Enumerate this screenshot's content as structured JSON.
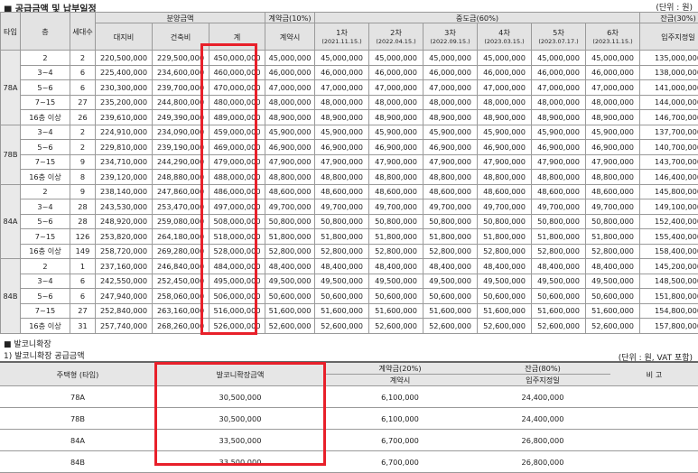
{
  "title": "■ 공급금액 및 납부일정",
  "unit": "(단위 : 원)",
  "headers": {
    "type": "타입",
    "floor": "층",
    "households": "세대수",
    "sale_price": "분양금액",
    "land": "대지비",
    "building": "건축비",
    "total": "계",
    "contract": "계약금(10%)",
    "contract_when": "계약시",
    "middle": "중도금(60%)",
    "rounds": [
      {
        "label": "1차",
        "date": "(2021.11.15.)"
      },
      {
        "label": "2차",
        "date": "(2022.04.15.)"
      },
      {
        "label": "3차",
        "date": "(2022.09.15.)"
      },
      {
        "label": "4차",
        "date": "(2023.03.15.)"
      },
      {
        "label": "5차",
        "date": "(2023.07.17.)"
      },
      {
        "label": "6차",
        "date": "(2023.11.15.)"
      }
    ],
    "balance": "잔금(30%)",
    "balance_when": "입주지정일"
  },
  "groups": [
    {
      "type": "78A",
      "rows": [
        {
          "floor": "2",
          "units": "2",
          "land": "220,500,000",
          "building": "229,500,000",
          "total": "450,000,000",
          "contract": "45,000,000",
          "mid": "45,000,000",
          "balance": "135,000,000"
        },
        {
          "floor": "3~4",
          "units": "6",
          "land": "225,400,000",
          "building": "234,600,000",
          "total": "460,000,000",
          "contract": "46,000,000",
          "mid": "46,000,000",
          "balance": "138,000,000"
        },
        {
          "floor": "5~6",
          "units": "6",
          "land": "230,300,000",
          "building": "239,700,000",
          "total": "470,000,000",
          "contract": "47,000,000",
          "mid": "47,000,000",
          "balance": "141,000,000"
        },
        {
          "floor": "7~15",
          "units": "27",
          "land": "235,200,000",
          "building": "244,800,000",
          "total": "480,000,000",
          "contract": "48,000,000",
          "mid": "48,000,000",
          "balance": "144,000,000"
        },
        {
          "floor": "16층 이상",
          "units": "26",
          "land": "239,610,000",
          "building": "249,390,000",
          "total": "489,000,000",
          "contract": "48,900,000",
          "mid": "48,900,000",
          "balance": "146,700,000"
        }
      ]
    },
    {
      "type": "78B",
      "rows": [
        {
          "floor": "3~4",
          "units": "2",
          "land": "224,910,000",
          "building": "234,090,000",
          "total": "459,000,000",
          "contract": "45,900,000",
          "mid": "45,900,000",
          "balance": "137,700,000"
        },
        {
          "floor": "5~6",
          "units": "2",
          "land": "229,810,000",
          "building": "239,190,000",
          "total": "469,000,000",
          "contract": "46,900,000",
          "mid": "46,900,000",
          "balance": "140,700,000"
        },
        {
          "floor": "7~15",
          "units": "9",
          "land": "234,710,000",
          "building": "244,290,000",
          "total": "479,000,000",
          "contract": "47,900,000",
          "mid": "47,900,000",
          "balance": "143,700,000"
        },
        {
          "floor": "16층 이상",
          "units": "8",
          "land": "239,120,000",
          "building": "248,880,000",
          "total": "488,000,000",
          "contract": "48,800,000",
          "mid": "48,800,000",
          "balance": "146,400,000"
        }
      ]
    },
    {
      "type": "84A",
      "rows": [
        {
          "floor": "2",
          "units": "9",
          "land": "238,140,000",
          "building": "247,860,000",
          "total": "486,000,000",
          "contract": "48,600,000",
          "mid": "48,600,000",
          "balance": "145,800,000"
        },
        {
          "floor": "3~4",
          "units": "28",
          "land": "243,530,000",
          "building": "253,470,000",
          "total": "497,000,000",
          "contract": "49,700,000",
          "mid": "49,700,000",
          "balance": "149,100,000"
        },
        {
          "floor": "5~6",
          "units": "28",
          "land": "248,920,000",
          "building": "259,080,000",
          "total": "508,000,000",
          "contract": "50,800,000",
          "mid": "50,800,000",
          "balance": "152,400,000"
        },
        {
          "floor": "7~15",
          "units": "126",
          "land": "253,820,000",
          "building": "264,180,000",
          "total": "518,000,000",
          "contract": "51,800,000",
          "mid": "51,800,000",
          "balance": "155,400,000"
        },
        {
          "floor": "16층 이상",
          "units": "149",
          "land": "258,720,000",
          "building": "269,280,000",
          "total": "528,000,000",
          "contract": "52,800,000",
          "mid": "52,800,000",
          "balance": "158,400,000"
        }
      ]
    },
    {
      "type": "84B",
      "rows": [
        {
          "floor": "2",
          "units": "1",
          "land": "237,160,000",
          "building": "246,840,000",
          "total": "484,000,000",
          "contract": "48,400,000",
          "mid": "48,400,000",
          "balance": "145,200,000"
        },
        {
          "floor": "3~4",
          "units": "6",
          "land": "242,550,000",
          "building": "252,450,000",
          "total": "495,000,000",
          "contract": "49,500,000",
          "mid": "49,500,000",
          "balance": "148,500,000"
        },
        {
          "floor": "5~6",
          "units": "6",
          "land": "247,940,000",
          "building": "258,060,000",
          "total": "506,000,000",
          "contract": "50,600,000",
          "mid": "50,600,000",
          "balance": "151,800,000"
        },
        {
          "floor": "7~15",
          "units": "27",
          "land": "252,840,000",
          "building": "263,160,000",
          "total": "516,000,000",
          "contract": "51,600,000",
          "mid": "51,600,000",
          "balance": "154,800,000"
        },
        {
          "floor": "16층 이상",
          "units": "31",
          "land": "257,740,000",
          "building": "268,260,000",
          "total": "526,000,000",
          "contract": "52,600,000",
          "mid": "52,600,000",
          "balance": "157,800,000"
        }
      ]
    }
  ],
  "balcony": {
    "section": "■ 발코니확장",
    "subtitle": "1) 발코니확장 공급금액",
    "unit": "(단위 : 원, VAT 포함)",
    "headers": {
      "type": "주택형 (타입)",
      "amount": "발코니확장금액",
      "contract": "계약금(20%)",
      "contract_when": "계약시",
      "balance": "잔금(80%)",
      "balance_when": "입주지정일",
      "note": "비 고"
    },
    "rows": [
      {
        "type": "78A",
        "amount": "30,500,000",
        "contract": "6,100,000",
        "balance": "24,400,000"
      },
      {
        "type": "78B",
        "amount": "30,500,000",
        "contract": "6,100,000",
        "balance": "24,400,000"
      },
      {
        "type": "84A",
        "amount": "33,500,000",
        "contract": "6,700,000",
        "balance": "26,800,000"
      },
      {
        "type": "84B",
        "amount": "33,500,000",
        "contract": "6,700,000",
        "balance": "26,800,000"
      }
    ]
  }
}
